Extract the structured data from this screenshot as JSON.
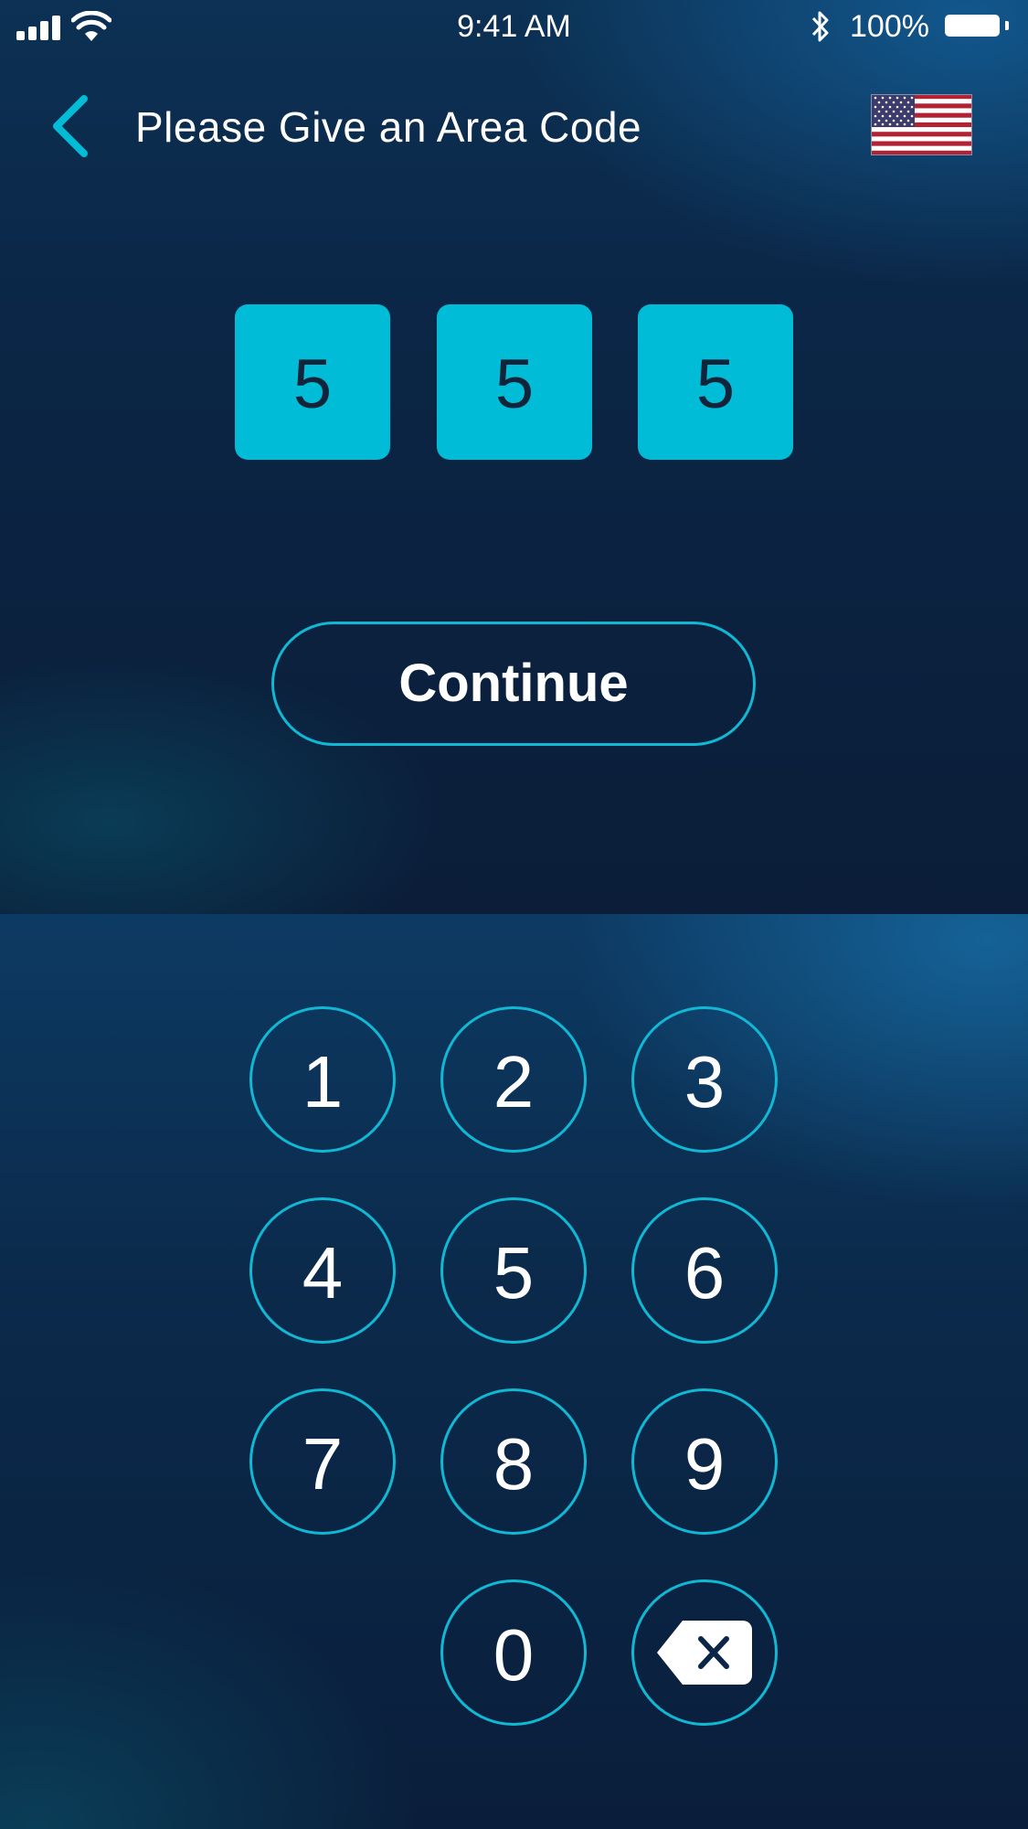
{
  "status_bar": {
    "time": "9:41 AM",
    "battery": "100%",
    "icons": [
      "signal-icon",
      "wifi-icon",
      "bluetooth-icon",
      "battery-icon"
    ]
  },
  "header": {
    "title": "Please Give an Area Code",
    "back_icon": "chevron-left-icon",
    "flag_icon": "us-flag-icon"
  },
  "code": {
    "digits": [
      "5",
      "5",
      "5"
    ]
  },
  "continue_label": "Continue",
  "keypad": {
    "keys": [
      "1",
      "2",
      "3",
      "4",
      "5",
      "6",
      "7",
      "8",
      "9",
      "0"
    ],
    "backspace_icon": "backspace-icon"
  },
  "colors": {
    "accent": "#00bcd6",
    "outline": "#10b8d4",
    "background": "#0b1f3a",
    "text": "#ffffff"
  }
}
